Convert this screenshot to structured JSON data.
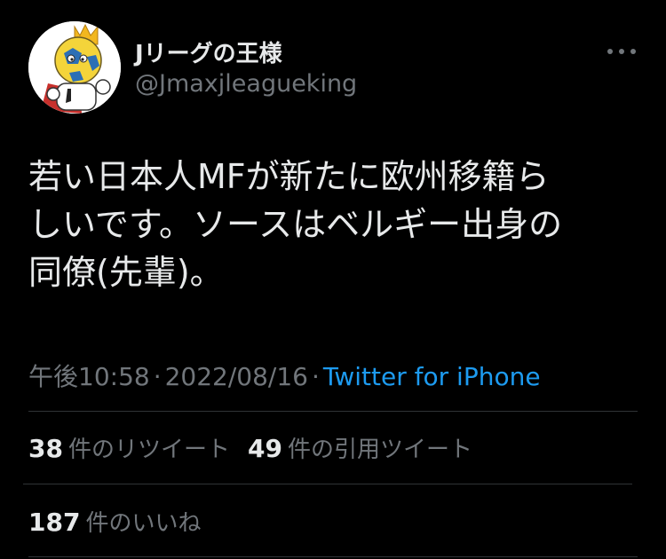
{
  "user": {
    "display_name": "Jリーグの王様",
    "handle": "@Jmaxjleagueking"
  },
  "tweet": {
    "lines": [
      "若い日本人MFが新たに欧州移籍ら",
      "しいです。ソースはベルギー出身の",
      "同僚(先輩)。"
    ]
  },
  "meta": {
    "time": "午後10:58",
    "separator": "·",
    "date": "2022/08/16",
    "source": "Twitter for iPhone"
  },
  "stats": {
    "retweets": {
      "count": "38",
      "label": "件のリツイート"
    },
    "quotes": {
      "count": "49",
      "label": "件の引用ツイート"
    },
    "likes": {
      "count": "187",
      "label": "件のいいね"
    }
  },
  "colors": {
    "background": "#000000",
    "text": "#e7e9ea",
    "secondary": "#71767b",
    "link": "#1d9bf0",
    "divider": "#2f3336"
  },
  "icons": {
    "avatar": "soccer-ball-king-mascot",
    "more": "more-horizontal-icon"
  }
}
